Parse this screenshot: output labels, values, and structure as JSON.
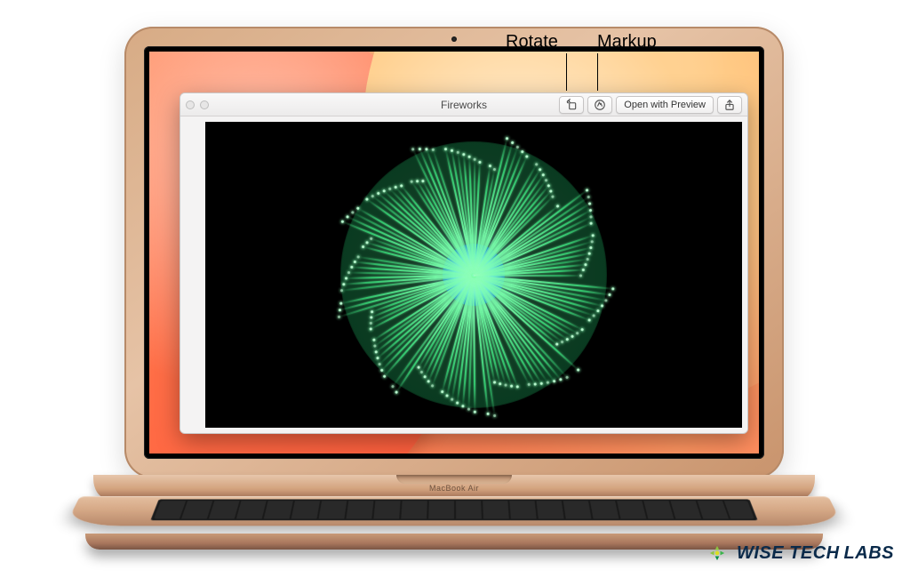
{
  "callouts": {
    "rotate": "Rotate",
    "markup": "Markup"
  },
  "quicklook": {
    "title": "Fireworks",
    "open_with_label": "Open with Preview",
    "icons": {
      "rotate": "rotate-left-icon",
      "markup": "markup-pen-icon",
      "share": "share-icon"
    }
  },
  "device": {
    "model_label": "MacBook Air"
  },
  "brand": {
    "line1": "WISE TECH",
    "line2": "LABS"
  }
}
